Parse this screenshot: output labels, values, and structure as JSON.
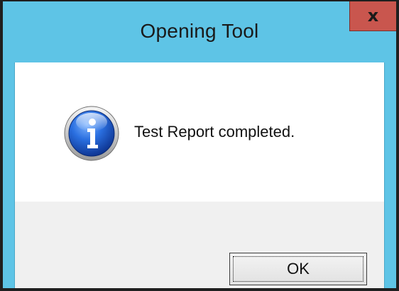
{
  "dialog": {
    "title": "Opening Tool",
    "message": "Test Report completed.",
    "ok_label": "OK",
    "close_label": "x",
    "icon": "info-icon"
  },
  "colors": {
    "titlebar": "#5ec4e6",
    "close_button": "#c9564e",
    "content_bg": "#ffffff",
    "button_area_bg": "#f0f0f0"
  }
}
